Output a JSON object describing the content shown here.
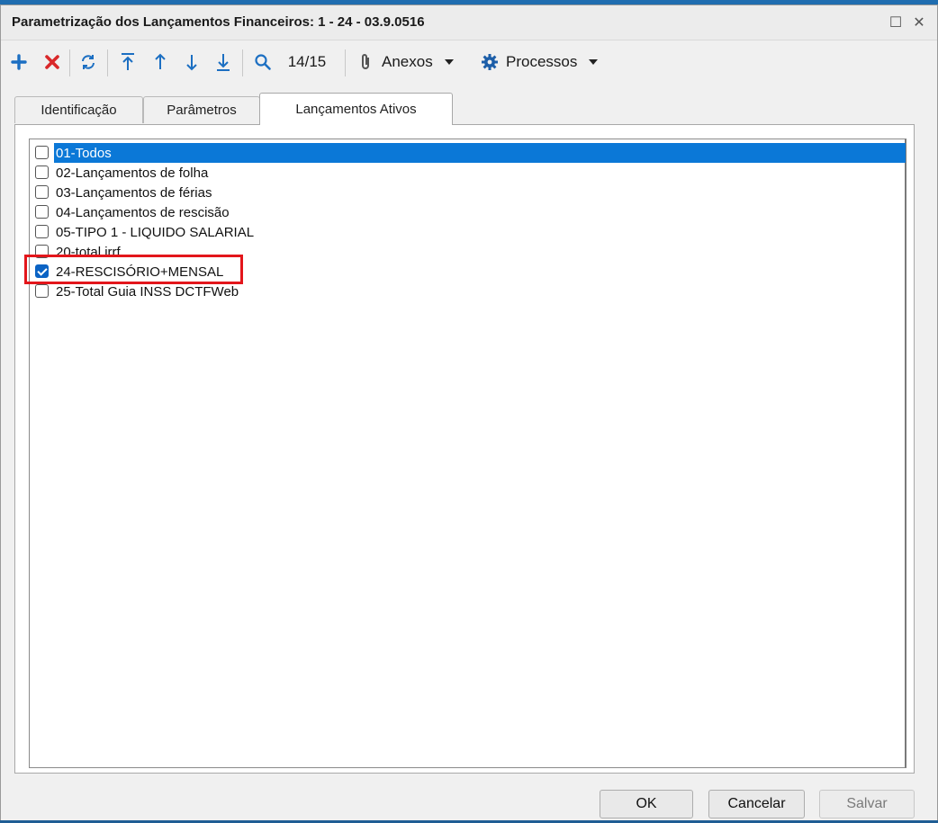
{
  "window": {
    "title": "Parametrização dos Lançamentos Financeiros: 1 - 24 - 03.9.0516",
    "maximize_glyph": "☐",
    "close_glyph": "✕"
  },
  "toolbar": {
    "record_position": "14/15",
    "anexos_label": "Anexos",
    "processos_label": "Processos"
  },
  "tabs": [
    {
      "label": "Identificação"
    },
    {
      "label": "Parâmetros"
    },
    {
      "label": "Lançamentos Ativos"
    }
  ],
  "list": {
    "items": [
      {
        "label": "01-Todos"
      },
      {
        "label": "02-Lançamentos de folha"
      },
      {
        "label": "03-Lançamentos de férias"
      },
      {
        "label": "04-Lançamentos de rescisão"
      },
      {
        "label": "05-TIPO 1 - LIQUIDO SALARIAL"
      },
      {
        "label": "20-total irrf"
      },
      {
        "label": "24-RESCISÓRIO+MENSAL"
      },
      {
        "label": "25-Total Guia INSS DCTFWeb"
      }
    ]
  },
  "buttons": {
    "ok": "OK",
    "cancel": "Cancelar",
    "save": "Salvar"
  },
  "colors": {
    "selection": "#0b78d7",
    "highlight_box": "#e3161b",
    "add_icon": "#1c6fc2",
    "delete_icon": "#d9282a"
  }
}
